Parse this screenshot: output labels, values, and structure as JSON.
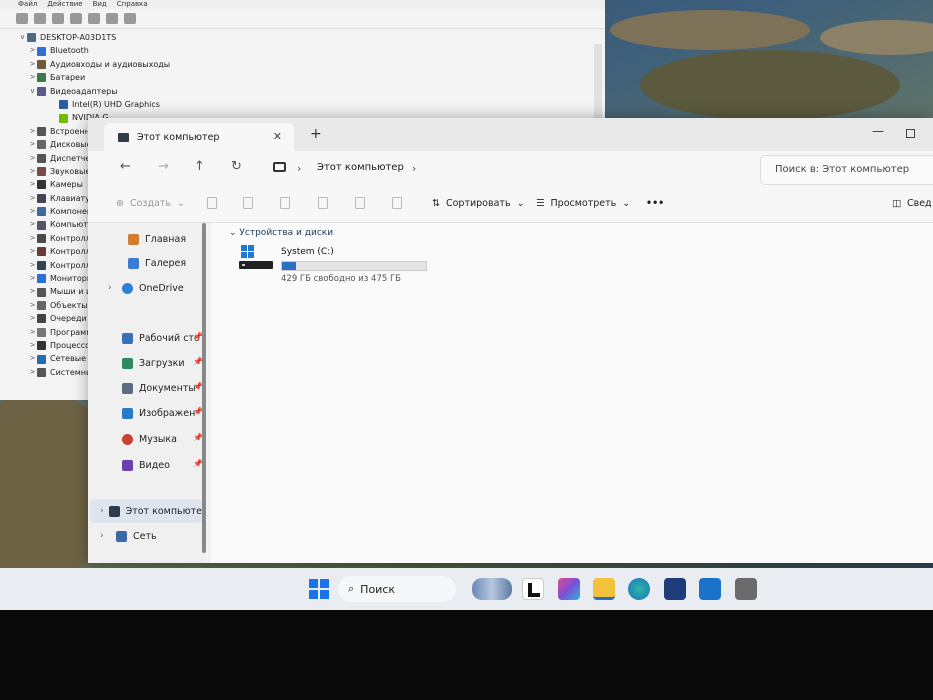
{
  "device_manager": {
    "menu": [
      "Файл",
      "Действие",
      "Вид",
      "Справка"
    ],
    "tree": [
      {
        "label": "DESKTOP-A03D1TS",
        "expander": "v",
        "level": 0
      },
      {
        "label": "Bluetooth",
        "expander": ">",
        "level": 1
      },
      {
        "label": "Аудиовходы и аудиовыходы",
        "expander": ">",
        "level": 1
      },
      {
        "label": "Батареи",
        "expander": ">",
        "level": 1
      },
      {
        "label": "Видеоадаптеры",
        "expander": "v",
        "level": 1
      },
      {
        "label": "Intel(R) UHD Graphics",
        "expander": "",
        "level": 2
      },
      {
        "label": "NVIDIA G",
        "expander": "",
        "level": 2
      },
      {
        "label": "Встроенное",
        "expander": ">",
        "level": 1
      },
      {
        "label": "Дисковые ус",
        "expander": ">",
        "level": 1
      },
      {
        "label": "Диспетчеры",
        "expander": ">",
        "level": 1
      },
      {
        "label": "Звуковые, ви",
        "expander": ">",
        "level": 1
      },
      {
        "label": "Камеры",
        "expander": ">",
        "level": 1
      },
      {
        "label": "Клавиатуры",
        "expander": ">",
        "level": 1
      },
      {
        "label": "Компоненты",
        "expander": ">",
        "level": 1
      },
      {
        "label": "Компьютер",
        "expander": ">",
        "level": 1
      },
      {
        "label": "Контроллер",
        "expander": ">",
        "level": 1
      },
      {
        "label": "Контроллер",
        "expander": ">",
        "level": 1
      },
      {
        "label": "Контроллер",
        "expander": ">",
        "level": 1
      },
      {
        "label": "Мониторы",
        "expander": ">",
        "level": 1
      },
      {
        "label": "Мыши и ин",
        "expander": ">",
        "level": 1
      },
      {
        "label": "Объекты об",
        "expander": ">",
        "level": 1
      },
      {
        "label": "Очереди пе",
        "expander": ">",
        "level": 1
      },
      {
        "label": "Программн",
        "expander": ">",
        "level": 1
      },
      {
        "label": "Процессоры",
        "expander": ">",
        "level": 1
      },
      {
        "label": "Сетевые ада",
        "expander": ">",
        "level": 1
      },
      {
        "label": "Системные",
        "expander": ">",
        "level": 1
      }
    ]
  },
  "explorer": {
    "tab_title": "Этот компьютер",
    "tab_close": "✕",
    "new_tab": "+",
    "minimize": "—",
    "nav": {
      "back": "←",
      "forward": "→",
      "up": "↑",
      "refresh": "↻"
    },
    "breadcrumb": "Этот компьютер",
    "breadcrumb_sep": "›",
    "search_placeholder": "Поиск в: Этот компьютер",
    "toolbar": {
      "create": "Создать",
      "sort": "Сортировать",
      "view": "Просмотреть",
      "more": "•••",
      "details": "Свед",
      "chevron": "⌄"
    },
    "sidebar": {
      "home": "Главная",
      "gallery": "Галерея",
      "onedrive": "OneDrive",
      "desktop": "Рабочий сто",
      "downloads": "Загрузки",
      "documents": "Документы",
      "pictures": "Изображен",
      "music": "Музыка",
      "video": "Видео",
      "this_pc": "Этот компьюте",
      "network": "Сеть",
      "pin": "📌",
      "expand": "›"
    },
    "group_label": "Устройства и диски",
    "group_chevron": "⌄",
    "drive": {
      "name": "System (C:)",
      "free_text": "429 ГБ свободно из 475 ГБ",
      "used_fraction": 0.097
    }
  },
  "taskbar": {
    "search_label": "Поиск",
    "search_icon": "⌕"
  }
}
